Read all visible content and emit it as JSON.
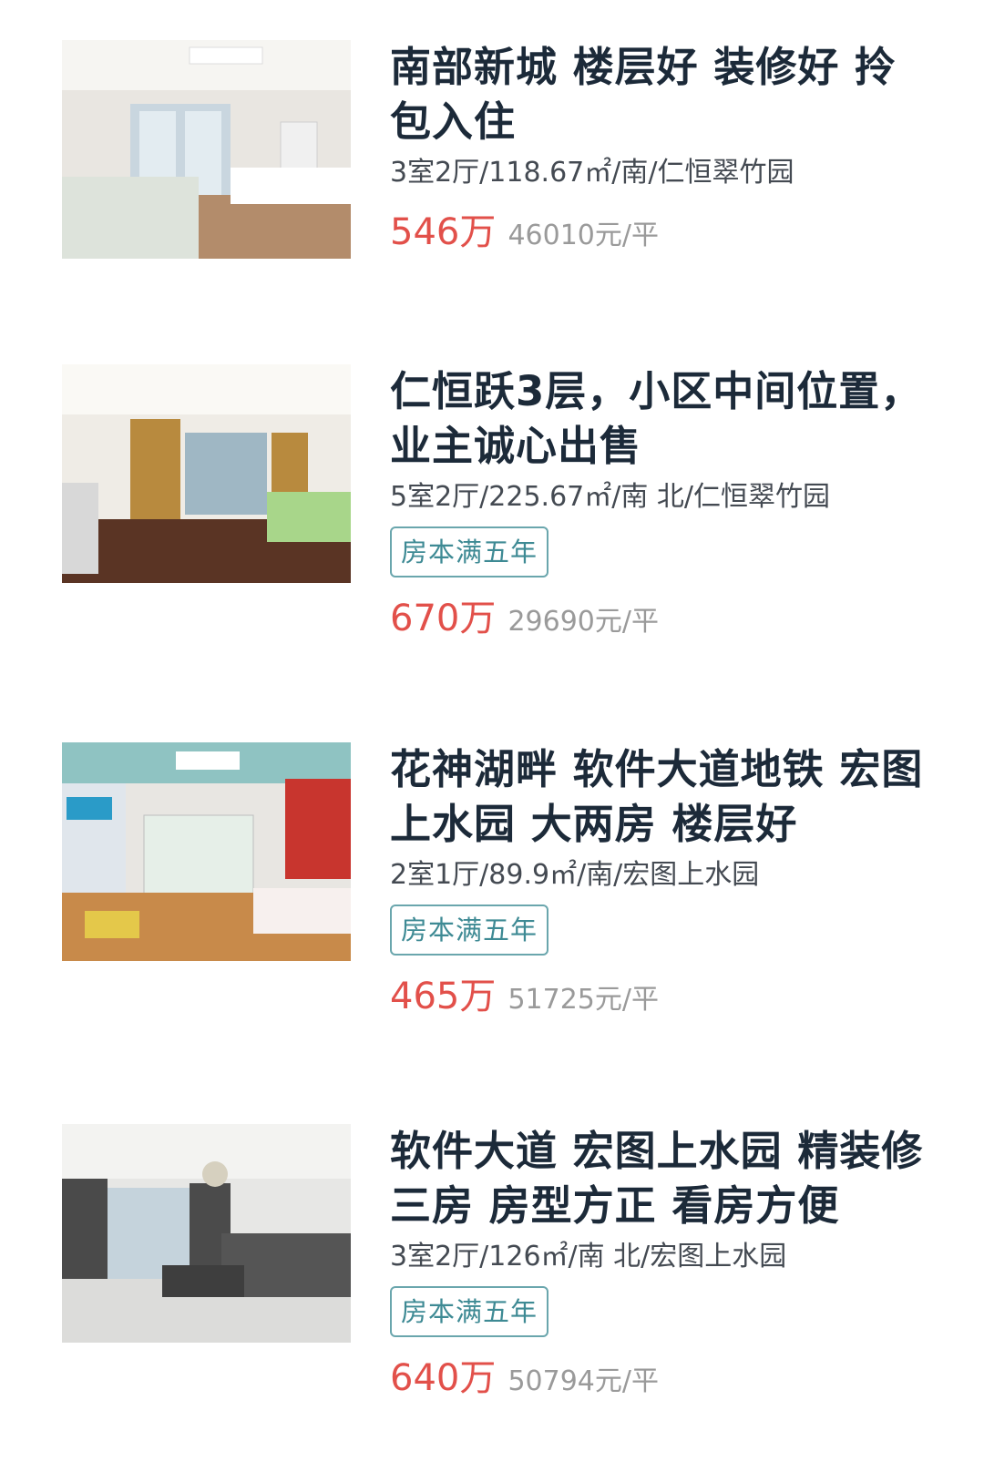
{
  "listings": [
    {
      "title": "南部新城 楼层好 装修好 拎包入住",
      "meta": "3室2厅/118.67㎡/南/仁恒翠竹园",
      "tag": "",
      "price": "546万",
      "unit_price": "46010元/平",
      "photo": "living-room-photo"
    },
    {
      "title": "仁恒跃3层，小区中间位置，业主诚心出售",
      "meta": "5室2厅/225.67㎡/南 北/仁恒翠竹园",
      "tag": "房本满五年",
      "price": "670万",
      "unit_price": "29690元/平",
      "photo": "bedroom-photo"
    },
    {
      "title": "花神湖畔 软件大道地铁 宏图上水园 大两房 楼层好",
      "meta": "2室1厅/89.9㎡/南/宏图上水园",
      "tag": "房本满五年",
      "price": "465万",
      "unit_price": "51725元/平",
      "photo": "living-room-photo"
    },
    {
      "title": "软件大道 宏图上水园 精装修三房 房型方正 看房方便",
      "meta": "3室2厅/126㎡/南 北/宏图上水园",
      "tag": "房本满五年",
      "price": "640万",
      "unit_price": "50794元/平",
      "photo": "living-room-photo"
    }
  ],
  "colors": {
    "title": "#1c2a39",
    "price": "#e2504a",
    "tag_border": "#6aa6ad",
    "tag_text": "#3e8a94",
    "muted": "#9a9a9a"
  }
}
